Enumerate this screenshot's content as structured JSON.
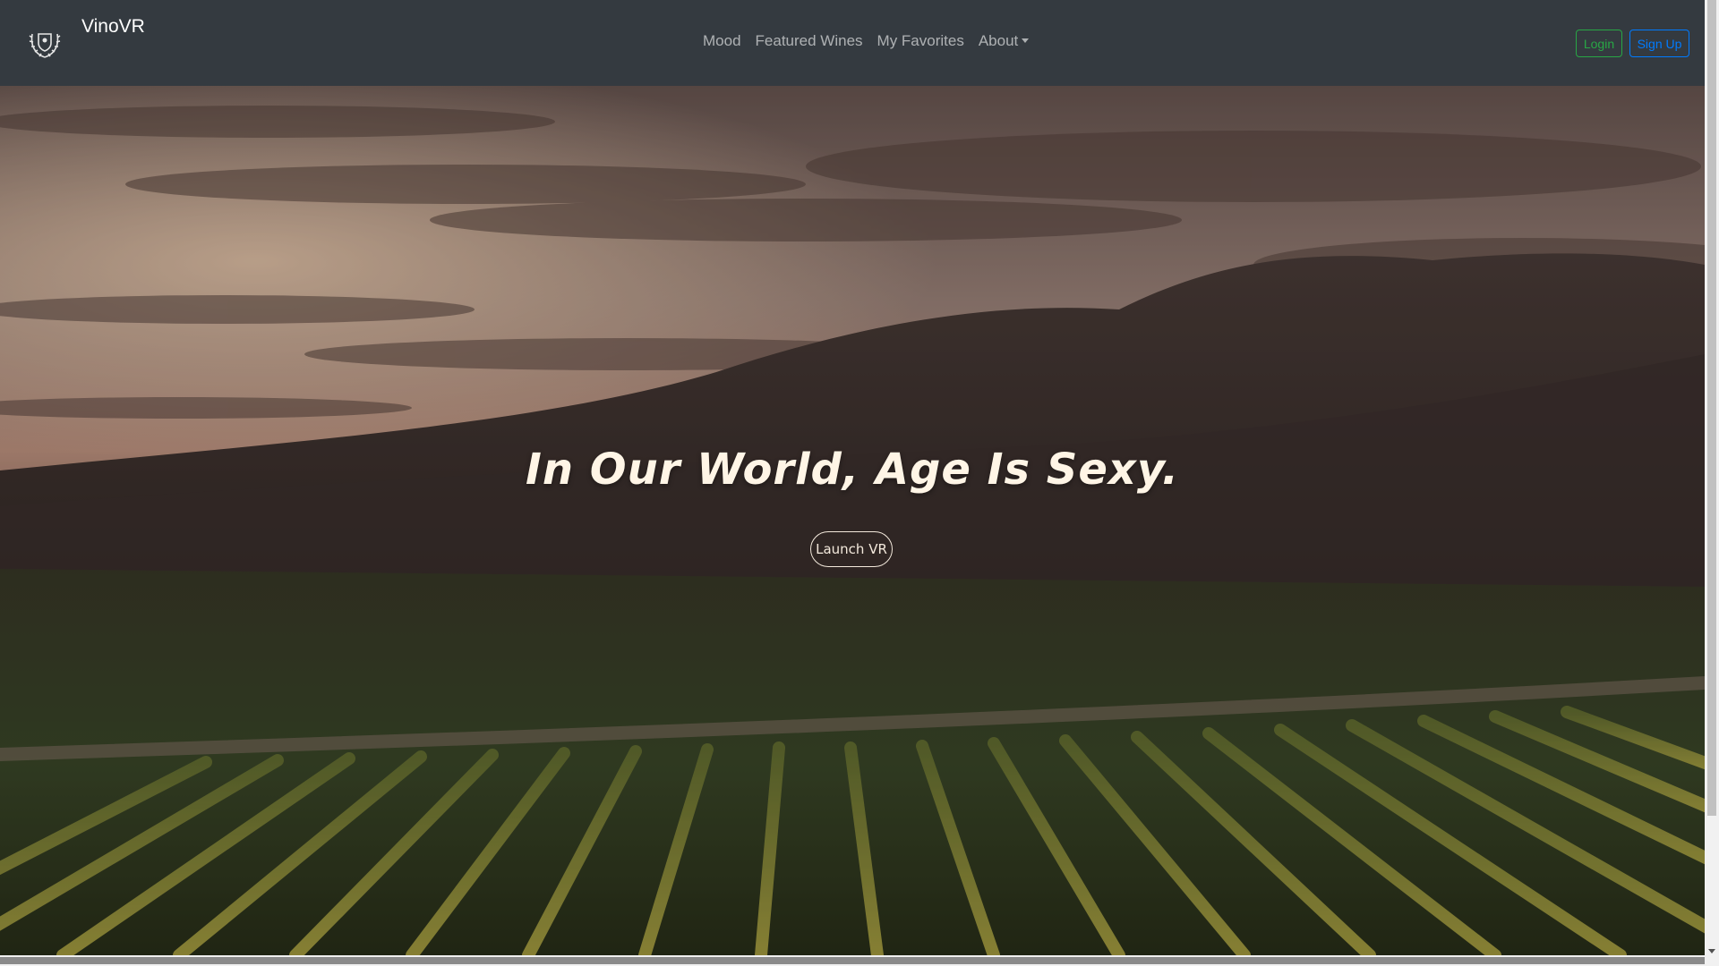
{
  "brand": {
    "name": "VinoVR",
    "logo": "laurel-crest-icon"
  },
  "nav": {
    "items": [
      {
        "label": "Mood"
      },
      {
        "label": "Featured Wines"
      },
      {
        "label": "My Favorites"
      },
      {
        "label": "About",
        "has_dropdown": true
      }
    ]
  },
  "auth": {
    "login_label": "Login",
    "signup_label": "Sign Up"
  },
  "hero": {
    "title": "In Our World, Age Is Sexy.",
    "button_label": "Launch VR",
    "background": "vineyard-hills-at-sunset"
  },
  "colors": {
    "navbar": "#343a40",
    "login": "#28a745",
    "signup": "#007bff",
    "hero_text": "#fff5e6"
  }
}
